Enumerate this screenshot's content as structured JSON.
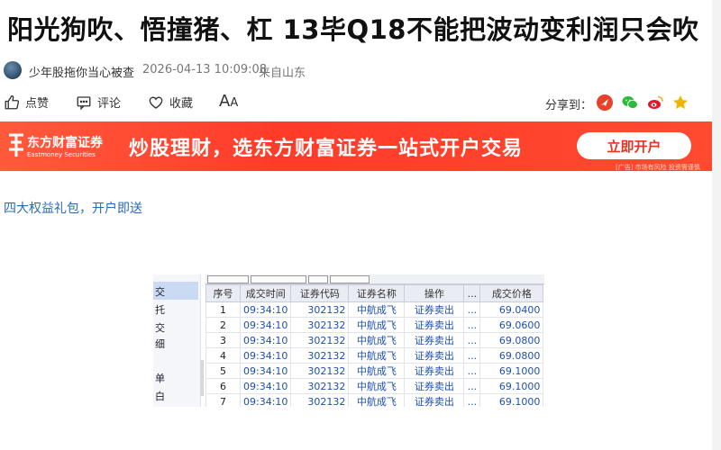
{
  "article": {
    "title": "阳光狗吹、悟撞猪、杠 13毕Q18不能把波动变利润只会吹",
    "author": "少年股拖你当心被查",
    "time": "2026-04-13 10:09:08",
    "source": "来自山东"
  },
  "actions": {
    "like": "点赞",
    "comment": "评论",
    "favorite": "收藏",
    "font_big": "A",
    "font_small": "A",
    "share_label": "分享到："
  },
  "banner": {
    "logo_cn": "东方财富证券",
    "logo_en": "Eastmoney Securities",
    "slogan": "炒股理财，选东方财富证券一站式开户交易",
    "button": "立即开户",
    "ad_tag": "[广告] 市场有风险 投资需谨慎",
    "bg_color": "#ff4a30",
    "button_text_color": "#e8321e"
  },
  "promo_link": "四大权益礼包，开户即送",
  "screenshot": {
    "sidebar": [
      "交",
      "托",
      "交",
      "细",
      "单",
      "白"
    ],
    "headers": [
      "序号",
      "成交时间",
      "证券代码",
      "证券名称",
      "操作",
      "...",
      "成交价格"
    ],
    "rows": [
      [
        "1",
        "09:34:10",
        "302132",
        "中航成飞",
        "证券卖出",
        "...",
        "69.0400"
      ],
      [
        "2",
        "09:34:10",
        "302132",
        "中航成飞",
        "证券卖出",
        "...",
        "69.0600"
      ],
      [
        "3",
        "09:34:10",
        "302132",
        "中航成飞",
        "证券卖出",
        "...",
        "69.0800"
      ],
      [
        "4",
        "09:34:10",
        "302132",
        "中航成飞",
        "证券卖出",
        "...",
        "69.0800"
      ],
      [
        "5",
        "09:34:10",
        "302132",
        "中航成飞",
        "证券卖出",
        "...",
        "69.1000"
      ],
      [
        "6",
        "09:34:10",
        "302132",
        "中航成飞",
        "证券卖出",
        "...",
        "69.1000"
      ],
      [
        "7",
        "09:34:10",
        "302132",
        "中航成飞",
        "证券卖出",
        "...",
        "69.1000"
      ]
    ]
  }
}
